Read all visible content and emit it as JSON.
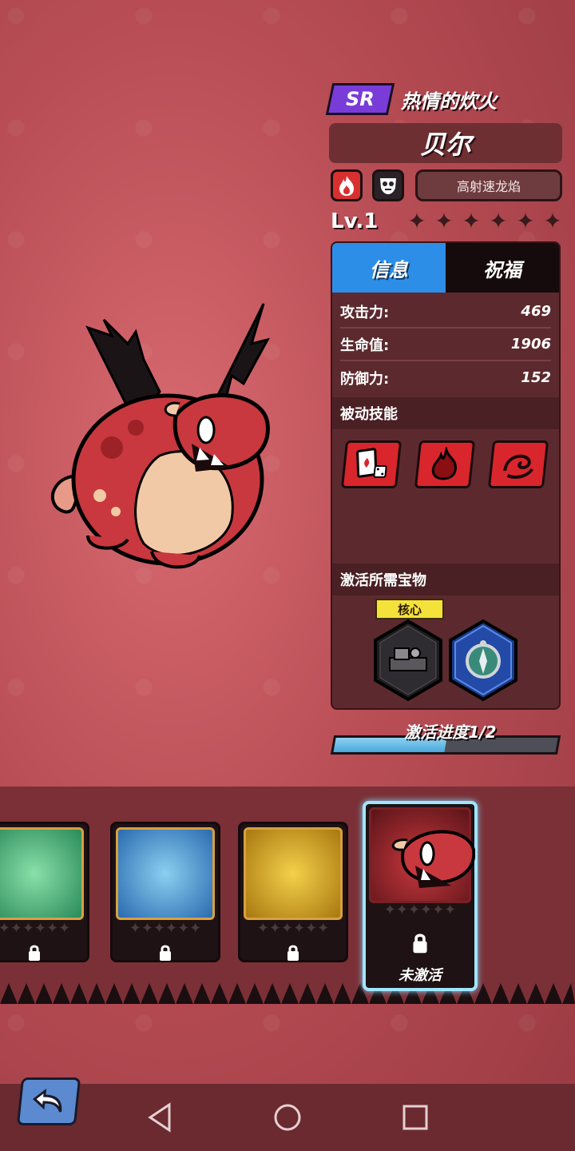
{
  "hero": {
    "rarity": "SR",
    "title": "热情的炊火",
    "name": "贝尔",
    "skill_name": "高射速龙焰",
    "level": "Lv.1",
    "stars_total": 6,
    "stars_filled": 0
  },
  "tabs": [
    {
      "label": "信息",
      "active": true
    },
    {
      "label": "祝福",
      "active": false
    }
  ],
  "stats": [
    {
      "label": "攻击力:",
      "value": "469"
    },
    {
      "label": "生命值:",
      "value": "1906"
    },
    {
      "label": "防御力:",
      "value": "152"
    }
  ],
  "sections": {
    "passive": "被动技能",
    "treasures": "激活所需宝物"
  },
  "passive_icons": [
    "card-dice-icon",
    "flame-icon",
    "swirl-icon"
  ],
  "treasure": {
    "core_tag": "核心",
    "items": [
      "vinyl-machine-icon",
      "compass-icon"
    ]
  },
  "progress": {
    "label": "激活进度1/2",
    "fraction": 0.5
  },
  "roster": {
    "cards": [
      {
        "name": "green-beast",
        "color": "#2a8a5a",
        "locked": true
      },
      {
        "name": "ice-beast",
        "color": "#2a6ab0",
        "locked": true
      },
      {
        "name": "gold-beast",
        "color": "#c8a020",
        "locked": true
      },
      {
        "name": "red-dragon",
        "color": "#a8282e",
        "locked": true,
        "selected": true
      }
    ],
    "selected_label": "未激活"
  },
  "colors": {
    "accent_blue": "#2d8ee8",
    "rarity_purple": "#7a3cd8",
    "core_yellow": "#f4e23a",
    "fire_red": "#d8302e"
  }
}
